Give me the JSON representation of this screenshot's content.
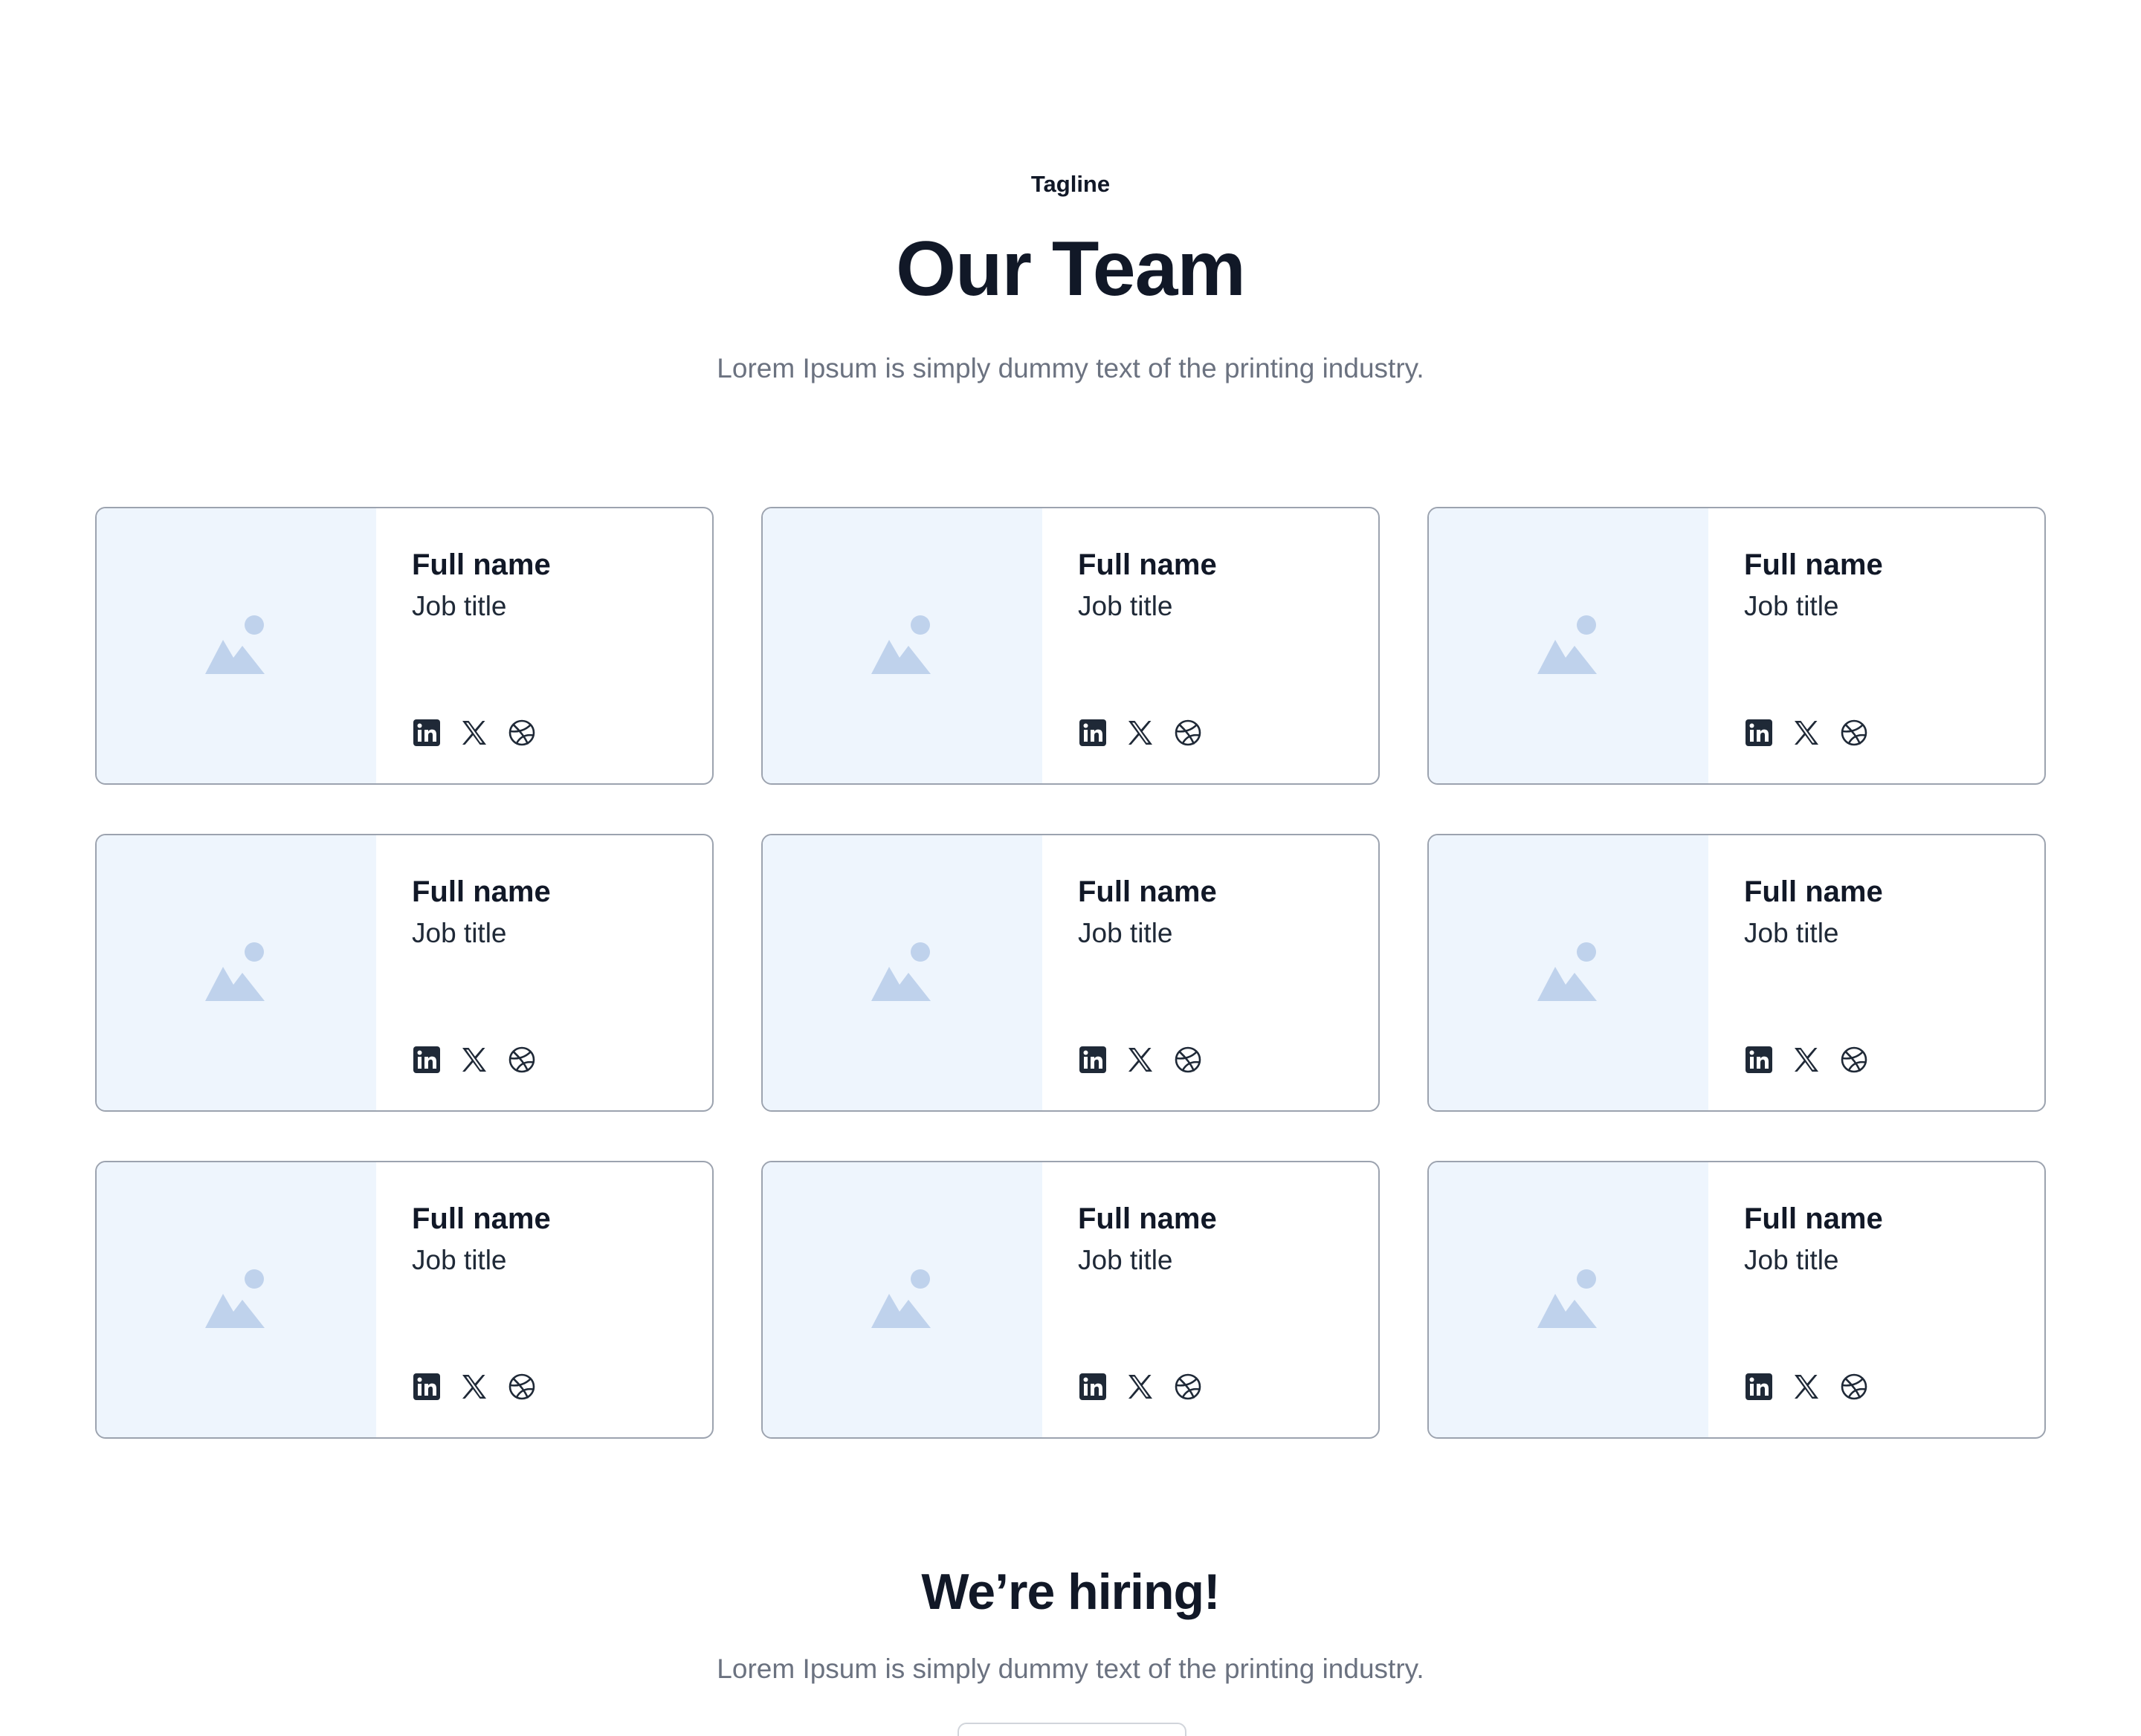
{
  "header": {
    "tagline": "Tagline",
    "title": "Our Team",
    "subtitle": "Lorem Ipsum is simply dummy text of the printing industry."
  },
  "team": {
    "members": [
      {
        "name": "Full name",
        "job_title": "Job title"
      },
      {
        "name": "Full name",
        "job_title": "Job title"
      },
      {
        "name": "Full name",
        "job_title": "Job title"
      },
      {
        "name": "Full name",
        "job_title": "Job title"
      },
      {
        "name": "Full name",
        "job_title": "Job title"
      },
      {
        "name": "Full name",
        "job_title": "Job title"
      },
      {
        "name": "Full name",
        "job_title": "Job title"
      },
      {
        "name": "Full name",
        "job_title": "Job title"
      },
      {
        "name": "Full name",
        "job_title": "Job title"
      }
    ],
    "photo_icon": "image-placeholder-icon",
    "social_icons": [
      "linkedin-icon",
      "x-icon",
      "dribbble-icon"
    ]
  },
  "hiring": {
    "title": "We’re hiring!",
    "subtitle": "Lorem Ipsum is simply dummy text of the printing industry.",
    "button_label": ""
  },
  "colors": {
    "text_primary": "#111827",
    "text_muted": "#6b7280",
    "photo_bg": "#eef5fd",
    "placeholder_icon": "#bfd2ec",
    "social_icon": "#1f2937",
    "card_border": "#9ca3af"
  }
}
